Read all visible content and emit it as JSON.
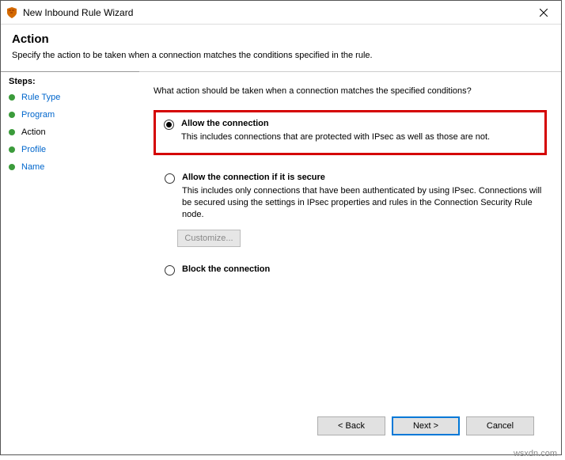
{
  "window": {
    "title": "New Inbound Rule Wizard"
  },
  "header": {
    "title": "Action",
    "description": "Specify the action to be taken when a connection matches the conditions specified in the rule."
  },
  "sidebar": {
    "title": "Steps:",
    "items": [
      {
        "label": "Rule Type",
        "current": false
      },
      {
        "label": "Program",
        "current": false
      },
      {
        "label": "Action",
        "current": true
      },
      {
        "label": "Profile",
        "current": false
      },
      {
        "label": "Name",
        "current": false
      }
    ]
  },
  "main": {
    "prompt": "What action should be taken when a connection matches the specified conditions?",
    "options": {
      "allow": {
        "title": "Allow the connection",
        "desc": "This includes connections that are protected with IPsec as well as those are not."
      },
      "secure": {
        "title": "Allow the connection if it is secure",
        "desc": "This includes only connections that have been authenticated by using IPsec. Connections will be secured using the settings in IPsec properties and rules in the Connection Security Rule node.",
        "customize": "Customize..."
      },
      "block": {
        "title": "Block the connection"
      }
    }
  },
  "footer": {
    "back": "< Back",
    "next": "Next >",
    "cancel": "Cancel"
  },
  "watermark": "wsxdn.com"
}
